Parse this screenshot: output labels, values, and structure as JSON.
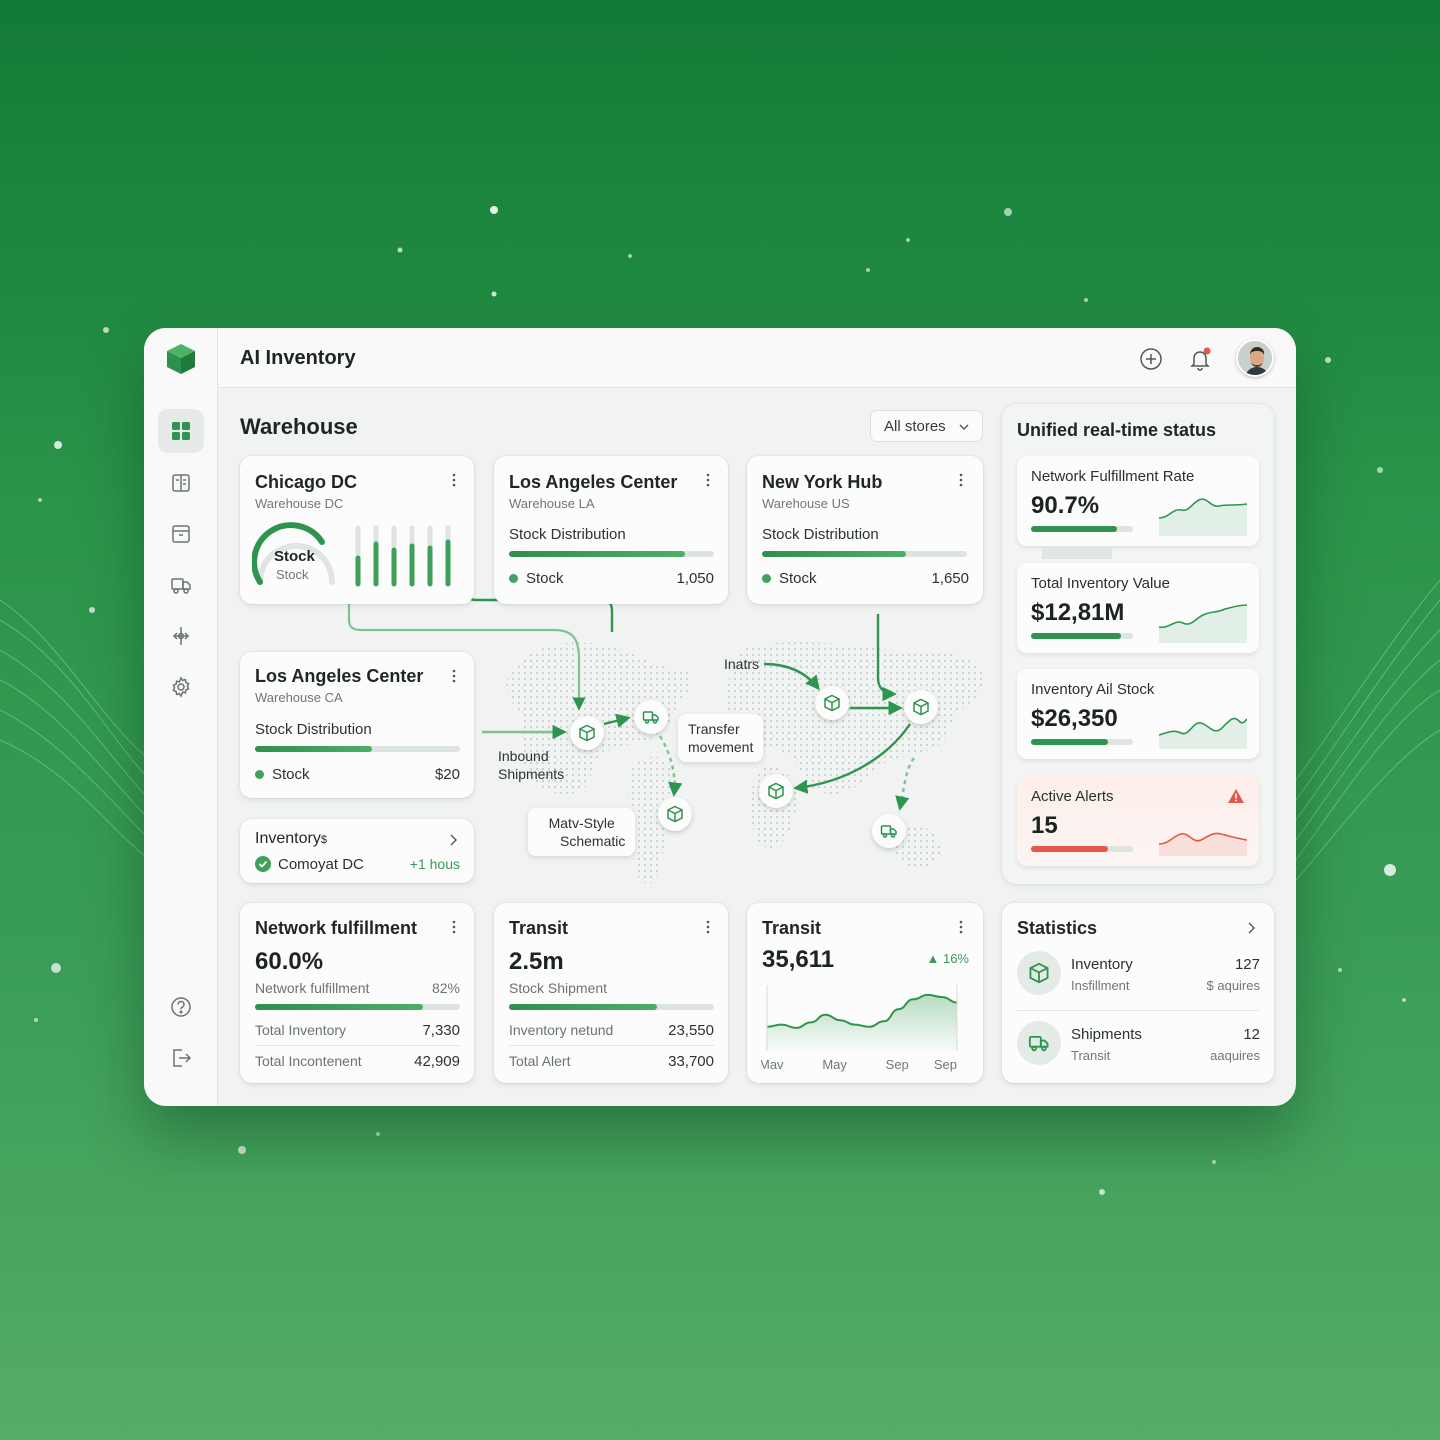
{
  "app": {
    "title": "AI Inventory"
  },
  "colors": {
    "accent": "#2f9450",
    "alert": "#e5574a",
    "window_bg": "#f1f3f2"
  },
  "sidebar": {
    "items": [
      {
        "icon": "grid-icon",
        "active": true
      },
      {
        "icon": "document-icon",
        "active": false
      },
      {
        "icon": "archive-icon",
        "active": false
      },
      {
        "icon": "truck-icon",
        "active": false
      },
      {
        "icon": "network-icon",
        "active": false
      },
      {
        "icon": "gear-icon",
        "active": false
      }
    ],
    "bottom": [
      {
        "icon": "help-icon"
      },
      {
        "icon": "logout-icon"
      }
    ]
  },
  "topbar": {
    "icons": [
      "plus-circle-icon",
      "bell-icon",
      "avatar"
    ]
  },
  "page": {
    "title": "Warehouse",
    "store_filter": "All stores"
  },
  "warehouses": {
    "chicago": {
      "title": "Chicago DC",
      "sub": "Warehouse DC",
      "gauge_title": "Stock",
      "gauge_sub": "Stock"
    },
    "la": {
      "title": "Los Angeles Center",
      "sub": "Warehouse LA",
      "section": "Stock Distribution",
      "legend": "Stock",
      "value": "1,050",
      "fill": 0.86
    },
    "ny": {
      "title": "New York Hub",
      "sub": "Warehouse US",
      "section": "Stock Distribution",
      "legend": "Stock",
      "value": "1,650",
      "fill": 0.7
    },
    "la_ca": {
      "title": "Los Angeles Center",
      "sub": "Warehouse CA",
      "section": "Stock Distribution",
      "legend": "Stock",
      "value": "$20",
      "fill": 0.57
    }
  },
  "inventory_card": {
    "title": "Inventory",
    "badge": "$",
    "item": "Comoyat DC",
    "time": "+1 hous"
  },
  "map": {
    "labels": {
      "inatrs": "Inatrs",
      "inbound_1": "Inbound",
      "inbound_2": "Shipments",
      "transfer_1": "Transfer",
      "transfer_2": "movement",
      "schematic_1": "Matv-Style",
      "schematic_2": "Schematic"
    }
  },
  "status_panel": {
    "title": "Unified real-time status",
    "cards": [
      {
        "label": "Network Fulfillment Rate",
        "value": "90.7%",
        "fill": 0.84
      },
      {
        "label": "Total Inventory Value",
        "value": "$12,81M",
        "fill": 0.88
      },
      {
        "label": "Inventory Ail Stock",
        "value": "$26,350",
        "fill": 0.75
      },
      {
        "label": "Active Alerts",
        "value": "15",
        "fill": 0.75,
        "alert": true
      }
    ]
  },
  "network_card": {
    "title": "Network fulfillment",
    "value": "60.0%",
    "sub": "Network fulfillment",
    "sub_value": "82%",
    "fill": 0.82,
    "rows": [
      {
        "label": "Total Inventory",
        "value": "7,330"
      },
      {
        "label": "Total Incontenent",
        "value": "42,909"
      }
    ]
  },
  "transit_card": {
    "title": "Transit",
    "value": "2.5m",
    "sub": "Stock Shipment",
    "fill": 0.72,
    "rows": [
      {
        "label": "Inventory netund",
        "value": "23,550"
      },
      {
        "label": "Total Alert",
        "value": "33,700"
      }
    ]
  },
  "transit_chart_card": {
    "title": "Transit",
    "value": "35,611",
    "delta": "16%"
  },
  "chart_data": {
    "type": "area",
    "title": "",
    "xlabel": "",
    "ylabel": "",
    "categories": [
      "Mav",
      "May",
      "Sep",
      "Sep"
    ],
    "x": [
      0,
      1,
      2,
      3,
      4,
      5,
      6,
      7,
      8,
      9,
      10,
      11,
      12,
      13
    ],
    "values": [
      22,
      24,
      21,
      26,
      33,
      28,
      24,
      22,
      27,
      38,
      47,
      51,
      49,
      44
    ],
    "ylim": [
      0,
      60
    ],
    "grid": false,
    "legend": "none"
  },
  "statistics": {
    "title": "Statistics",
    "rows": [
      {
        "icon": "box-icon",
        "title": "Inventory",
        "sub": "Insfillment",
        "value": "127",
        "value_sub": "$ aquires"
      },
      {
        "icon": "truck-icon",
        "title": "Shipments",
        "sub": "Transit",
        "value": "12",
        "value_sub": "aaquires"
      }
    ]
  }
}
